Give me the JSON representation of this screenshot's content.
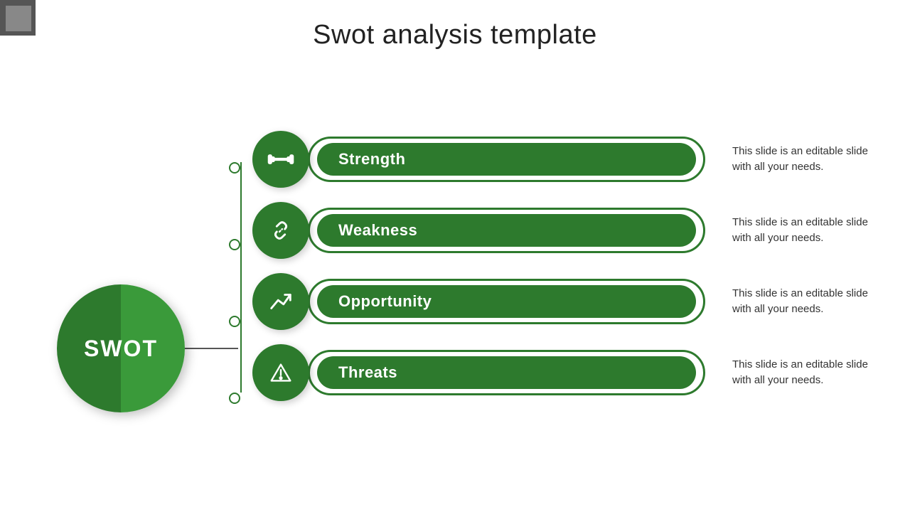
{
  "decorations": {
    "square1": "deco-1",
    "square2": "deco-2"
  },
  "title": "Swot analysis template",
  "swot_label": "SWOT",
  "items": [
    {
      "id": "strength",
      "label": "Strength",
      "description": "This slide is an editable slide with all your needs.",
      "icon": "dumbbell"
    },
    {
      "id": "weakness",
      "label": "Weakness",
      "description": "This slide is an editable slide with all your needs.",
      "icon": "broken-link"
    },
    {
      "id": "opportunity",
      "label": "Opportunity",
      "description": "This slide is an editable slide with all your needs.",
      "icon": "trending-up"
    },
    {
      "id": "threats",
      "label": "Threats",
      "description": "This slide is an editable slide with all your needs.",
      "icon": "warning"
    }
  ],
  "colors": {
    "green_dark": "#2d7a2d",
    "green_mid": "#3a9a3a",
    "text_dark": "#222222",
    "text_body": "#333333"
  }
}
